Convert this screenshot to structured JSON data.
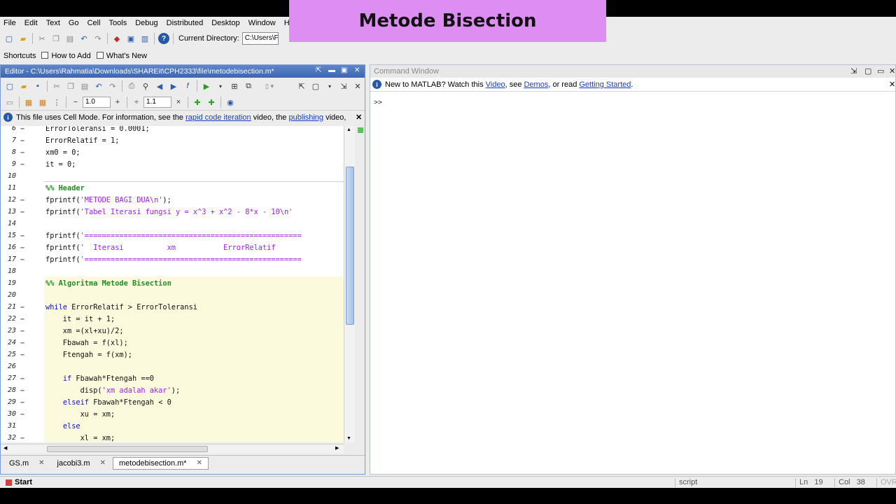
{
  "overlay": {
    "title": "Metode Bisection"
  },
  "menu": [
    "File",
    "Edit",
    "Text",
    "Go",
    "Cell",
    "Tools",
    "Debug",
    "Distributed",
    "Desktop",
    "Window",
    "H"
  ],
  "toolbar": {
    "current_directory_label": "Current Directory:",
    "current_directory_value": "C:\\Users\\F"
  },
  "shortcuts": {
    "label": "Shortcuts",
    "how_to_add": "How to Add",
    "whats_new": "What's New"
  },
  "editor": {
    "title": "Editor - C:\\Users\\Rahmatia\\Downloads\\SHAREit\\CPH2333\\file\\metodebisection.m*",
    "cell_step1": "1.0",
    "cell_step2": "1.1",
    "info_text_1": "This file uses Cell Mode. For information, see the ",
    "info_link_1": "rapid code iteration",
    "info_text_2": " video, the ",
    "info_link_2": "publishing",
    "info_text_3": " video,",
    "lines": [
      {
        "n": "6",
        "dash": "−",
        "code": "ErrorToleransi = 0.0001;"
      },
      {
        "n": "7",
        "dash": "−",
        "code": "ErrorRelatif = 1;"
      },
      {
        "n": "8",
        "dash": "−",
        "code": "xm0 = 0;"
      },
      {
        "n": "9",
        "dash": "−",
        "code": "it = 0;"
      },
      {
        "n": "10",
        "dash": "",
        "code": ""
      },
      {
        "n": "11",
        "dash": "",
        "code": "%% Header"
      },
      {
        "n": "12",
        "dash": "−",
        "code_pre": "fprintf(",
        "code_str": "'METODE BAGI DUA\\n'",
        "code_post": ");"
      },
      {
        "n": "13",
        "dash": "−",
        "code_pre": "fprintf(",
        "code_str": "'Tabel Iterasi fungsi y = x^3 + x^2 - 8*x - 10\\n'",
        "code_post": ""
      },
      {
        "n": "14",
        "dash": "",
        "code": ""
      },
      {
        "n": "15",
        "dash": "−",
        "code_pre": "fprintf(",
        "code_str": "'==================================================",
        "code_post": ""
      },
      {
        "n": "16",
        "dash": "−",
        "code_pre": "fprintf(",
        "code_str": "'  Iterasi          xm           ErrorRelatif",
        "code_post": ""
      },
      {
        "n": "17",
        "dash": "−",
        "code_pre": "fprintf(",
        "code_str": "'==================================================",
        "code_post": ""
      },
      {
        "n": "18",
        "dash": "",
        "code": ""
      },
      {
        "n": "19",
        "dash": "",
        "code": "%% Algoritma Metode Bisection"
      },
      {
        "n": "20",
        "dash": "",
        "code": ""
      },
      {
        "n": "21",
        "dash": "−",
        "code_kw": "while",
        "code_post": " ErrorRelatif > ErrorToleransi"
      },
      {
        "n": "22",
        "dash": "−",
        "code": "    it = it + 1;"
      },
      {
        "n": "23",
        "dash": "−",
        "code": "    xm =(xl+xu)/2;"
      },
      {
        "n": "24",
        "dash": "−",
        "code": "    Fbawah = f(xl);"
      },
      {
        "n": "25",
        "dash": "−",
        "code": "    Ftengah = f(xm);"
      },
      {
        "n": "26",
        "dash": "",
        "code": ""
      },
      {
        "n": "27",
        "dash": "−",
        "code_indent": "    ",
        "code_kw": "if",
        "code_post": " Fbawah*Ftengah ==0"
      },
      {
        "n": "28",
        "dash": "−",
        "code_pre": "        disp(",
        "code_str": "'xm adalah akar'",
        "code_post": ");"
      },
      {
        "n": "29",
        "dash": "−",
        "code_indent": "    ",
        "code_kw": "elseif",
        "code_post": " Fbawah*Ftengah < 0"
      },
      {
        "n": "30",
        "dash": "−",
        "code": "        xu = xm;"
      },
      {
        "n": "31",
        "dash": "",
        "code_indent": "    ",
        "code_kw": "else",
        "code_post": ""
      },
      {
        "n": "32",
        "dash": "−",
        "code": "        xl = xm;"
      }
    ],
    "tabs": [
      "GS.m",
      "jacobi3.m",
      "metodebisection.m*"
    ]
  },
  "command_window": {
    "title": "Command Window",
    "info_text_1": "New to MATLAB? Watch this ",
    "info_link_1": "Video",
    "info_text_2": ", see ",
    "info_link_2": "Demos",
    "info_text_3": ", or read ",
    "info_link_3": "Getting Started",
    "info_text_4": ".",
    "prompt": ">>"
  },
  "statusbar": {
    "start": "Start",
    "mode": "script",
    "ln_label": "Ln",
    "ln": "19",
    "col_label": "Col",
    "col": "38",
    "ovr": "OVR"
  },
  "colors": {
    "title_bar": "#3c66b3",
    "overlay_bg": "#de8ef2",
    "cell_bg": "#fcfadd",
    "keyword": "#1010d0",
    "string": "#a020f0",
    "comment": "#228b22"
  }
}
